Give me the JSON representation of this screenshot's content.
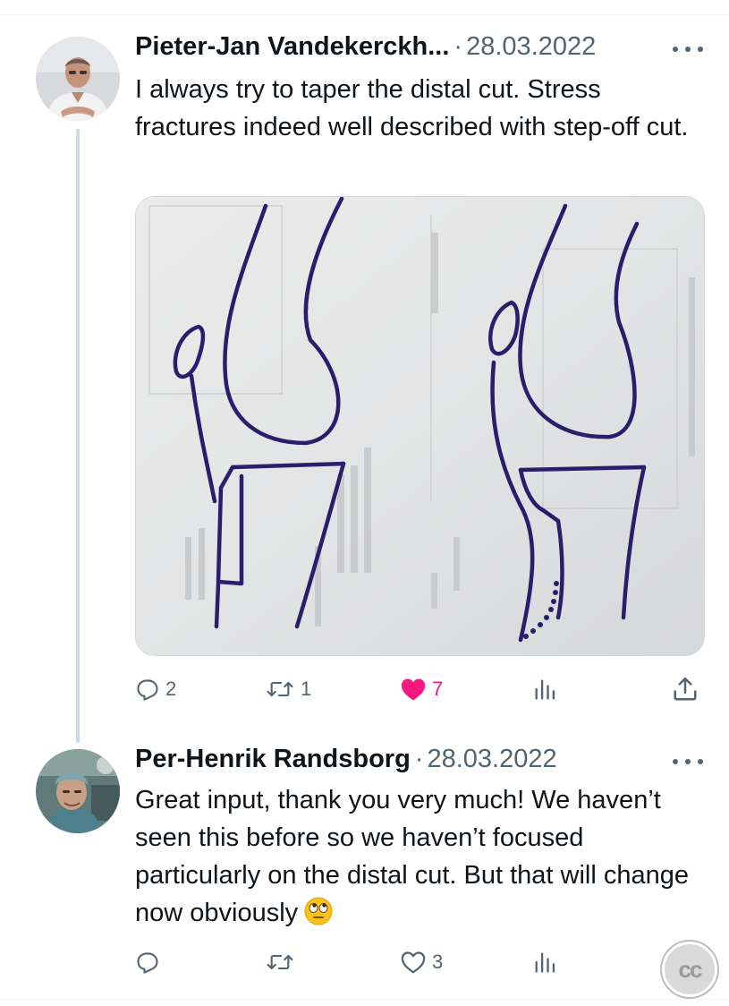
{
  "tweets": [
    {
      "author": "Pieter-Jan Vandekerckh...",
      "separator": "·",
      "date": "28.03.2022",
      "text": "I always try to taper the distal cut. Stress fractures indeed well described with step-off cut.",
      "has_media": true,
      "media_icon": "knee-osteotomy-sketch",
      "actions": {
        "reply_count": "2",
        "retweet_count": "1",
        "like_count": "7",
        "liked": true
      }
    },
    {
      "author": "Per-Henrik Randsborg",
      "separator": "·",
      "date": "28.03.2022",
      "text": "Great input, thank you very much! We haven’t seen this before so we haven’t focused particularly on the distal cut. But that will change now obviously",
      "emoji": "face-with-rolling-eyes",
      "actions": {
        "reply_count": "",
        "retweet_count": "",
        "like_count": "3",
        "liked": false
      }
    }
  ],
  "icons": {
    "reply": "reply-icon",
    "retweet": "retweet-icon",
    "like": "heart-icon",
    "views": "views-icon",
    "share": "share-icon",
    "more": "more-icon"
  },
  "badge": {
    "label": "cc"
  },
  "colors": {
    "text": "#0f1419",
    "secondary": "#536471",
    "like": "#f91880",
    "thread_line": "#cfd9de",
    "ink": "#2a1d6b"
  }
}
